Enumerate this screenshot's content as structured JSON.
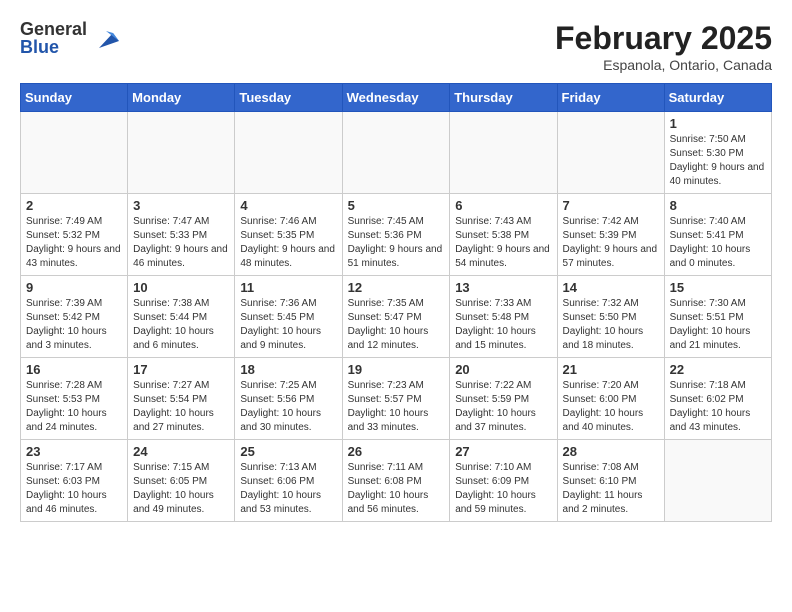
{
  "logo": {
    "general": "General",
    "blue": "Blue"
  },
  "title": "February 2025",
  "location": "Espanola, Ontario, Canada",
  "weekdays": [
    "Sunday",
    "Monday",
    "Tuesday",
    "Wednesday",
    "Thursday",
    "Friday",
    "Saturday"
  ],
  "weeks": [
    [
      {
        "day": "",
        "info": ""
      },
      {
        "day": "",
        "info": ""
      },
      {
        "day": "",
        "info": ""
      },
      {
        "day": "",
        "info": ""
      },
      {
        "day": "",
        "info": ""
      },
      {
        "day": "",
        "info": ""
      },
      {
        "day": "1",
        "info": "Sunrise: 7:50 AM\nSunset: 5:30 PM\nDaylight: 9 hours and 40 minutes."
      }
    ],
    [
      {
        "day": "2",
        "info": "Sunrise: 7:49 AM\nSunset: 5:32 PM\nDaylight: 9 hours and 43 minutes."
      },
      {
        "day": "3",
        "info": "Sunrise: 7:47 AM\nSunset: 5:33 PM\nDaylight: 9 hours and 46 minutes."
      },
      {
        "day": "4",
        "info": "Sunrise: 7:46 AM\nSunset: 5:35 PM\nDaylight: 9 hours and 48 minutes."
      },
      {
        "day": "5",
        "info": "Sunrise: 7:45 AM\nSunset: 5:36 PM\nDaylight: 9 hours and 51 minutes."
      },
      {
        "day": "6",
        "info": "Sunrise: 7:43 AM\nSunset: 5:38 PM\nDaylight: 9 hours and 54 minutes."
      },
      {
        "day": "7",
        "info": "Sunrise: 7:42 AM\nSunset: 5:39 PM\nDaylight: 9 hours and 57 minutes."
      },
      {
        "day": "8",
        "info": "Sunrise: 7:40 AM\nSunset: 5:41 PM\nDaylight: 10 hours and 0 minutes."
      }
    ],
    [
      {
        "day": "9",
        "info": "Sunrise: 7:39 AM\nSunset: 5:42 PM\nDaylight: 10 hours and 3 minutes."
      },
      {
        "day": "10",
        "info": "Sunrise: 7:38 AM\nSunset: 5:44 PM\nDaylight: 10 hours and 6 minutes."
      },
      {
        "day": "11",
        "info": "Sunrise: 7:36 AM\nSunset: 5:45 PM\nDaylight: 10 hours and 9 minutes."
      },
      {
        "day": "12",
        "info": "Sunrise: 7:35 AM\nSunset: 5:47 PM\nDaylight: 10 hours and 12 minutes."
      },
      {
        "day": "13",
        "info": "Sunrise: 7:33 AM\nSunset: 5:48 PM\nDaylight: 10 hours and 15 minutes."
      },
      {
        "day": "14",
        "info": "Sunrise: 7:32 AM\nSunset: 5:50 PM\nDaylight: 10 hours and 18 minutes."
      },
      {
        "day": "15",
        "info": "Sunrise: 7:30 AM\nSunset: 5:51 PM\nDaylight: 10 hours and 21 minutes."
      }
    ],
    [
      {
        "day": "16",
        "info": "Sunrise: 7:28 AM\nSunset: 5:53 PM\nDaylight: 10 hours and 24 minutes."
      },
      {
        "day": "17",
        "info": "Sunrise: 7:27 AM\nSunset: 5:54 PM\nDaylight: 10 hours and 27 minutes."
      },
      {
        "day": "18",
        "info": "Sunrise: 7:25 AM\nSunset: 5:56 PM\nDaylight: 10 hours and 30 minutes."
      },
      {
        "day": "19",
        "info": "Sunrise: 7:23 AM\nSunset: 5:57 PM\nDaylight: 10 hours and 33 minutes."
      },
      {
        "day": "20",
        "info": "Sunrise: 7:22 AM\nSunset: 5:59 PM\nDaylight: 10 hours and 37 minutes."
      },
      {
        "day": "21",
        "info": "Sunrise: 7:20 AM\nSunset: 6:00 PM\nDaylight: 10 hours and 40 minutes."
      },
      {
        "day": "22",
        "info": "Sunrise: 7:18 AM\nSunset: 6:02 PM\nDaylight: 10 hours and 43 minutes."
      }
    ],
    [
      {
        "day": "23",
        "info": "Sunrise: 7:17 AM\nSunset: 6:03 PM\nDaylight: 10 hours and 46 minutes."
      },
      {
        "day": "24",
        "info": "Sunrise: 7:15 AM\nSunset: 6:05 PM\nDaylight: 10 hours and 49 minutes."
      },
      {
        "day": "25",
        "info": "Sunrise: 7:13 AM\nSunset: 6:06 PM\nDaylight: 10 hours and 53 minutes."
      },
      {
        "day": "26",
        "info": "Sunrise: 7:11 AM\nSunset: 6:08 PM\nDaylight: 10 hours and 56 minutes."
      },
      {
        "day": "27",
        "info": "Sunrise: 7:10 AM\nSunset: 6:09 PM\nDaylight: 10 hours and 59 minutes."
      },
      {
        "day": "28",
        "info": "Sunrise: 7:08 AM\nSunset: 6:10 PM\nDaylight: 11 hours and 2 minutes."
      },
      {
        "day": "",
        "info": ""
      }
    ]
  ]
}
